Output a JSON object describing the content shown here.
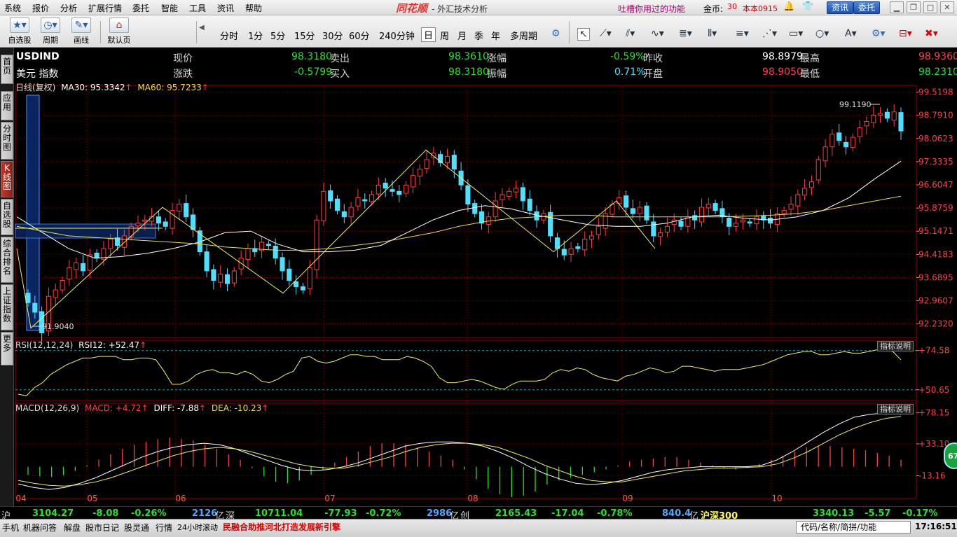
{
  "menubar": {
    "menus": [
      "系统",
      "报价",
      "分析",
      "扩展行情",
      "委托",
      "智能",
      "工具",
      "资讯",
      "帮助"
    ],
    "logo": "同花顺",
    "subtitle": "- 外汇技术分析",
    "promo": "吐槽你用过的功能",
    "coin_label": "金币:",
    "coin_count": "30",
    "account": "本本0915",
    "news_button": "资讯",
    "trade_button": "委托"
  },
  "toolbar": {
    "buttons": [
      "自选股",
      "周期",
      "画线",
      "默认页"
    ],
    "periods": [
      "分时",
      "1分",
      "5分",
      "15分",
      "30分",
      "60分",
      "240分钟",
      "日",
      "周",
      "月",
      "季",
      "年",
      "多周期"
    ],
    "active_period": "日"
  },
  "leftbar": {
    "tabs": [
      "首页",
      "应用",
      "分时图",
      "K线图",
      "自选股",
      "综合排名",
      "上证指数",
      "更多"
    ],
    "active": "K线图"
  },
  "quote": {
    "symbol": "USDIND",
    "name": "美元 指数",
    "price_label": "现价",
    "price": "98.3180",
    "ask_label": "卖出",
    "ask": "98.3610",
    "chgpct_label": "涨幅",
    "chgpct": "-0.59%",
    "prevclose_label": "昨收",
    "prevclose": "98.8979",
    "high_label": "最高",
    "high": "98.9360",
    "change_label": "涨跌",
    "change": "-0.5799",
    "bid_label": "买入",
    "bid": "98.3180",
    "amp_label": "振幅",
    "amp": "0.71%",
    "open_label": "开盘",
    "open": "98.9050",
    "low_label": "最低",
    "low": "98.2310"
  },
  "main_indicator": {
    "label": "日线(复权)",
    "ma30": "MA30: 95.3342",
    "ma60": "MA60: 95.7233",
    "max_marker": "99.1190",
    "min_marker": "91.9040"
  },
  "rsi": {
    "label": "RSI(12,12,24)",
    "value": "RSI12: +52.47",
    "help": "指标说明"
  },
  "macd": {
    "label": "MACD(12,26,9)",
    "macd": "MACD: +4.72",
    "diff": "DIFF: -7.88",
    "dea": "DEA: -10.23",
    "help": "指标说明"
  },
  "indexbar": {
    "sh": {
      "label": "沪",
      "value": "3104.27",
      "chg": "-8.08",
      "pct": "-0.26%",
      "amount": "2126",
      "unit": "亿"
    },
    "sz": {
      "label": "深",
      "value": "10711.04",
      "chg": "-77.93",
      "pct": "-0.72%",
      "amount": "2986",
      "unit": "亿"
    },
    "cy": {
      "label": "创",
      "value": "2165.43",
      "chg": "-17.04",
      "pct": "-0.78%",
      "amount": "840.4",
      "unit": "亿"
    },
    "hs300": {
      "label": "沪深300",
      "value": "3340.13",
      "chg": "-5.57",
      "pct": "-0.17%"
    }
  },
  "statusbar": {
    "items": [
      "手机",
      "机器问答",
      "解盘",
      "股市日记",
      "股灵通",
      "行情",
      "24小时滚动"
    ],
    "news": "民融合助推河北打造发展新引擎",
    "search_placeholder": "代码/名称/简拼/功能",
    "clock": "17:16:51"
  },
  "float_ball": "67",
  "colors": {
    "up": "#ff3c3c",
    "down": "#4fe0ff",
    "ma30": "#ffffff",
    "ma60": "#e8e040",
    "grid": "#8b0000"
  },
  "chart_data": [
    {
      "type": "candlestick",
      "title": "USDIND",
      "x": [
        "04",
        "05",
        "06",
        "07",
        "08",
        "09",
        "10"
      ],
      "yticks": [
        99.5198,
        98.791,
        98.0623,
        97.3335,
        96.6047,
        95.8759,
        95.1471,
        94.4183,
        93.6895,
        92.9607,
        92.232
      ],
      "ylim": [
        91.85,
        99.6
      ],
      "max": 99.119,
      "min": 91.904,
      "closes": [
        92.9,
        92.6,
        91.95,
        93.1,
        93.3,
        93.6,
        94.0,
        94.15,
        93.9,
        94.4,
        94.3,
        94.6,
        94.9,
        94.7,
        95.0,
        95.3,
        95.4,
        95.5,
        95.6,
        95.4,
        95.3,
        95.8,
        96.0,
        95.6,
        95.2,
        94.5,
        93.9,
        93.6,
        93.8,
        93.5,
        93.9,
        94.3,
        94.6,
        94.5,
        94.8,
        94.7,
        94.3,
        93.9,
        93.6,
        93.4,
        93.3,
        94.0,
        95.5,
        96.4,
        96.1,
        95.8,
        95.6,
        95.9,
        96.2,
        96.1,
        96.3,
        96.6,
        96.5,
        96.4,
        96.3,
        96.6,
        96.9,
        97.1,
        97.4,
        97.6,
        97.3,
        97.5,
        97.1,
        96.6,
        96.0,
        95.7,
        95.4,
        95.6,
        96.1,
        96.3,
        96.4,
        96.5,
        96.1,
        95.8,
        95.5,
        95.7,
        95.0,
        94.6,
        94.4,
        94.6,
        94.6,
        94.9,
        95.0,
        95.3,
        95.7,
        96.0,
        96.2,
        95.9,
        95.7,
        95.9,
        95.5,
        95.0,
        95.1,
        95.3,
        95.5,
        95.3,
        95.6,
        95.5,
        95.9,
        96.0,
        95.8,
        95.6,
        95.3,
        95.4,
        95.5,
        95.4,
        95.6,
        95.5,
        95.4,
        95.7,
        95.8,
        96.0,
        96.3,
        96.5,
        96.7,
        97.4,
        97.8,
        98.2,
        98.0,
        97.8,
        98.1,
        98.4,
        98.6,
        98.8,
        98.85,
        98.7,
        98.9,
        98.3
      ],
      "ma30": [
        95.6,
        95.1,
        94.6,
        94.3,
        94.35,
        94.45,
        94.6,
        94.8,
        95.1,
        95.15,
        94.75,
        94.5,
        94.5,
        94.55,
        94.7,
        95.1,
        95.5,
        95.8,
        95.95,
        95.85,
        95.65,
        95.5,
        95.35,
        95.3,
        95.3,
        95.4,
        95.6,
        95.65,
        95.55,
        95.5,
        95.6,
        95.8,
        96.2,
        96.8,
        97.35
      ],
      "ma60": [
        95.3,
        95.15,
        95.0,
        94.95,
        94.9,
        94.85,
        94.8,
        94.75,
        94.65,
        94.6,
        94.55,
        94.55,
        94.6,
        94.7,
        94.8,
        94.95,
        95.1,
        95.3,
        95.45,
        95.55,
        95.6,
        95.65,
        95.65,
        95.6,
        95.6,
        95.6,
        95.6,
        95.6,
        95.62,
        95.65,
        95.7,
        95.8,
        95.95,
        96.1,
        96.25
      ]
    },
    {
      "type": "line",
      "title": "RSI(12,12,24)",
      "ylim": [
        45,
        80
      ],
      "yticks": [
        74.58,
        50.65
      ],
      "values": [
        48,
        47,
        52,
        55,
        60,
        63,
        66,
        68,
        70,
        70,
        71,
        71,
        71,
        69,
        69,
        70,
        70,
        69,
        62,
        54,
        54,
        56,
        60,
        62,
        63,
        61,
        61,
        60,
        62,
        60,
        56,
        55,
        57,
        60,
        62,
        70,
        71,
        68,
        67,
        68,
        70,
        72,
        72,
        71,
        71,
        69,
        69,
        69,
        71,
        70,
        68,
        65,
        58,
        55,
        55,
        56,
        57,
        56,
        54,
        52,
        51,
        54,
        56,
        56,
        56,
        57,
        61,
        63,
        62,
        64,
        63,
        60,
        58,
        57,
        56,
        59,
        60,
        62,
        64,
        63,
        61,
        62,
        65,
        65,
        64,
        63,
        62,
        63,
        63,
        63,
        64,
        65,
        66,
        68,
        70,
        72,
        73,
        74,
        74,
        72,
        72,
        73,
        74,
        73,
        73,
        74,
        75,
        75,
        74,
        69
      ],
      "reference": [
        74.58,
        50.65
      ]
    },
    {
      "type": "bar+line",
      "title": "MACD(12,26,9)",
      "ylim": [
        -40,
        90
      ],
      "yticks": [
        78.15,
        33.1,
        -13.16
      ],
      "macd": [
        -12,
        -14,
        -15,
        -12,
        -6,
        2,
        10,
        18,
        26,
        32,
        36,
        40,
        42,
        40,
        38,
        32,
        26,
        18,
        10,
        -2,
        -14,
        -22,
        -24,
        -20,
        -12,
        -4,
        6,
        14,
        22,
        30,
        34,
        34,
        32,
        28,
        22,
        16,
        10,
        -4,
        -18,
        -32,
        -40,
        -44,
        -42,
        -36,
        -26,
        -20,
        -16,
        -12,
        -8,
        -4,
        2,
        8,
        10,
        12,
        14,
        14,
        10,
        6,
        2,
        -2,
        -4,
        -2,
        4,
        10,
        16,
        22,
        28,
        30,
        30,
        28,
        26,
        24,
        20,
        16,
        10
      ],
      "diff": [
        -25,
        -30,
        -33,
        -30,
        -24,
        -16,
        -6,
        4,
        14,
        22,
        28,
        32,
        34,
        32,
        26,
        18,
        10,
        2,
        -4,
        -6,
        -4,
        0,
        6,
        14,
        22,
        30,
        34,
        36,
        36,
        34,
        30,
        22,
        12,
        0,
        -10,
        -18,
        -24,
        -26,
        -24,
        -20,
        -14,
        -8,
        -4,
        -2,
        0,
        0,
        0,
        0,
        2,
        10,
        22,
        36,
        50,
        62,
        72,
        76,
        78,
        76
      ],
      "dea": [
        -20,
        -24,
        -27,
        -28,
        -26,
        -22,
        -16,
        -8,
        0,
        8,
        16,
        22,
        26,
        28,
        26,
        22,
        16,
        10,
        4,
        0,
        -2,
        -2,
        2,
        8,
        14,
        22,
        28,
        32,
        34,
        34,
        32,
        28,
        20,
        12,
        2,
        -6,
        -14,
        -20,
        -22,
        -22,
        -18,
        -14,
        -10,
        -6,
        -4,
        -2,
        -2,
        -1,
        0,
        4,
        12,
        22,
        34,
        46,
        56,
        64,
        70,
        73
      ]
    }
  ]
}
